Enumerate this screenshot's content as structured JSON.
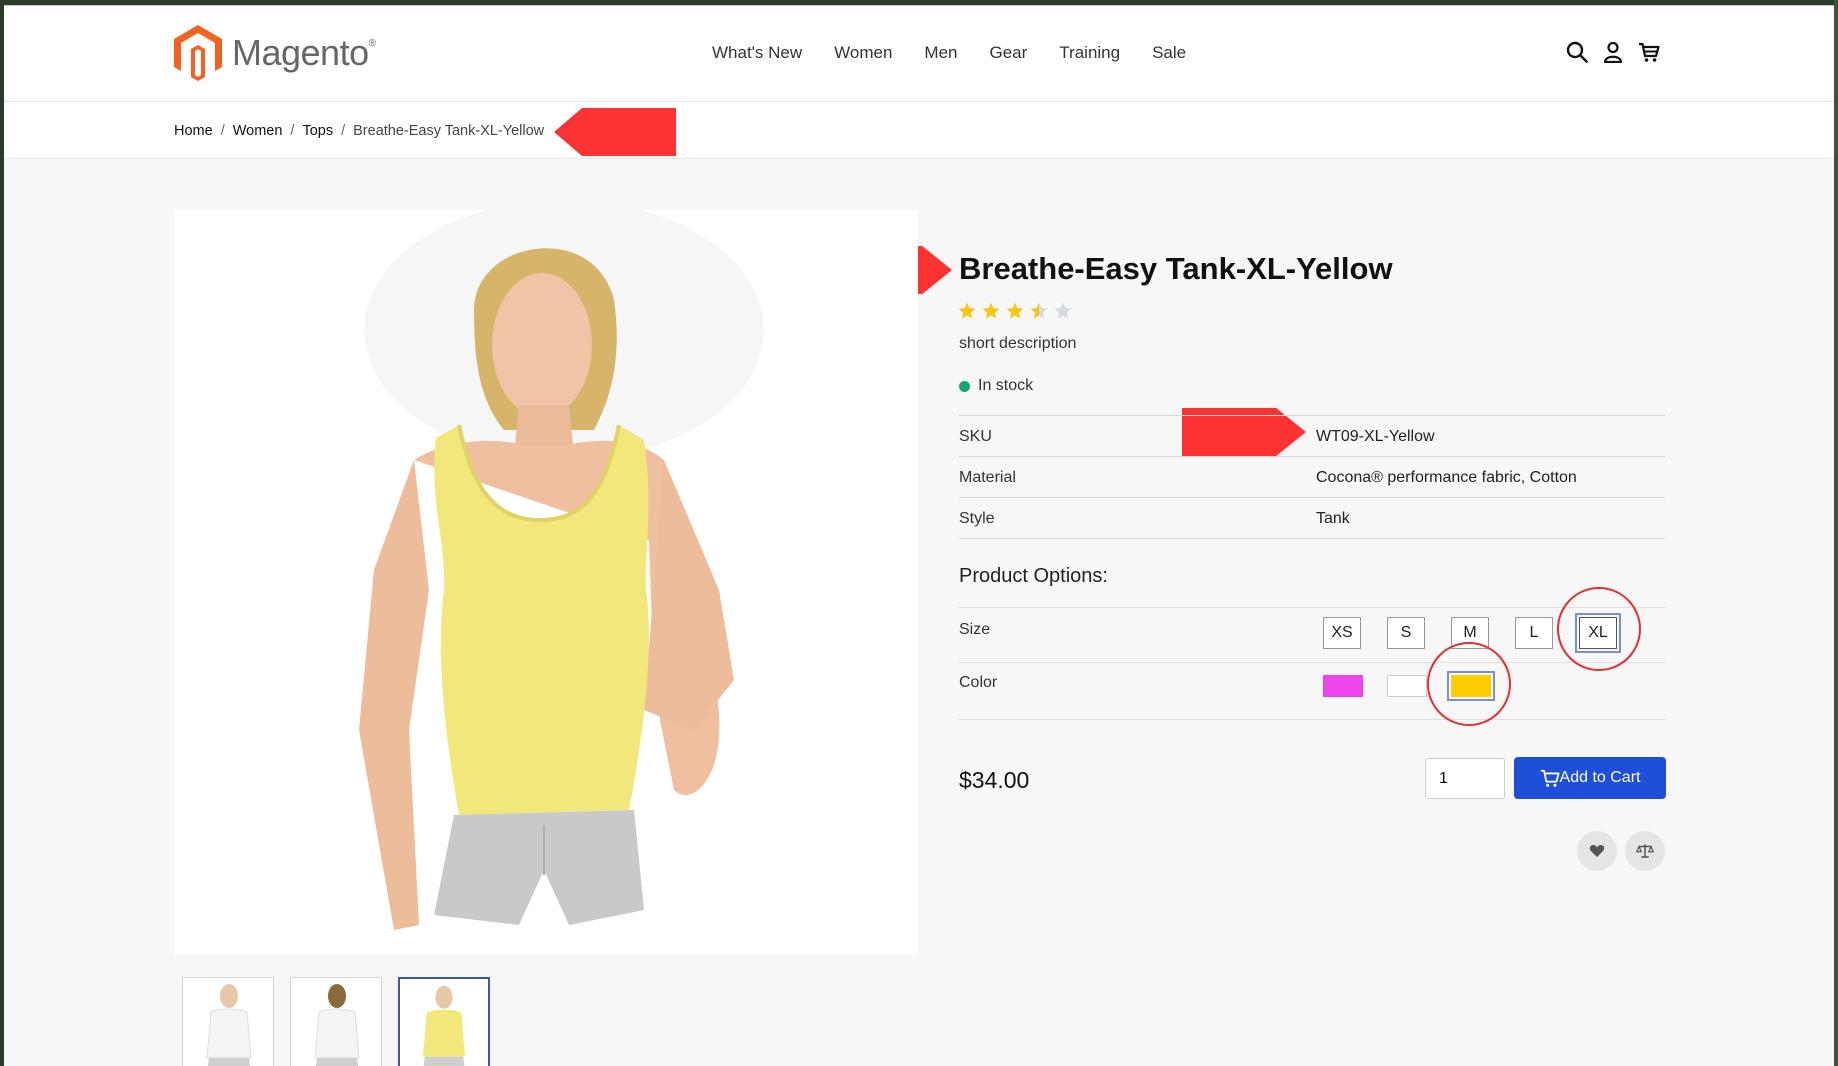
{
  "header": {
    "logo_text": "Magento",
    "logo_reg": "®",
    "nav": [
      "What's New",
      "Women",
      "Men",
      "Gear",
      "Training",
      "Sale"
    ],
    "icons": [
      "search-icon",
      "account-icon",
      "cart-icon"
    ]
  },
  "breadcrumb": {
    "items": [
      "Home",
      "Women",
      "Tops"
    ],
    "separator": "/",
    "current": "Breathe-Easy Tank-XL-Yellow"
  },
  "product": {
    "title": "Breathe-Easy Tank-XL-Yellow",
    "rating": 3.5,
    "rating_max": 5,
    "short_description": "short description",
    "stock": "In stock",
    "attributes": [
      {
        "label": "SKU",
        "value": "WT09-XL-Yellow"
      },
      {
        "label": "Material",
        "value": "Cocona® performance fabric, Cotton"
      },
      {
        "label": "Style",
        "value": "Tank"
      }
    ],
    "options_title": "Product Options:",
    "size_label": "Size",
    "sizes": [
      "XS",
      "S",
      "M",
      "L",
      "XL"
    ],
    "selected_size": "XL",
    "color_label": "Color",
    "colors": [
      "#ee44ee",
      "#ffffff",
      "#ffcc00"
    ],
    "selected_color": "#ffcc00",
    "price": "$34.00",
    "qty": "1",
    "add_to_cart": "Add to Cart"
  },
  "gallery": {
    "thumbnails": [
      "white-tank-front",
      "white-tank-back",
      "yellow-tank-front"
    ],
    "active_thumbnail": 3
  },
  "colors": {
    "accent": "#1f4fd8",
    "annotation": "#ff3333",
    "stock": "#17a673",
    "star": "#f5c518"
  }
}
